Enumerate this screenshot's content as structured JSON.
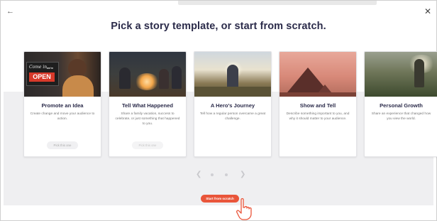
{
  "header": {
    "title": "Pick a story template, or start from scratch.",
    "back_icon": "back-arrow-icon",
    "close_icon": "close-icon"
  },
  "cards": [
    {
      "name": "Promote an Idea",
      "description": "Create change and move your audience to action.",
      "button": "Pick this one",
      "thumb_text": [
        "Come in",
        "we're",
        "OPEN"
      ]
    },
    {
      "name": "Tell What Happened",
      "description": "Share a family vacation, success to celebrate, or just something that happened to you.",
      "button": "Pick this one"
    },
    {
      "name": "A Hero's Journey",
      "description": "Tell how a regular person overcame a great challenge."
    },
    {
      "name": "Show and Tell",
      "description": "Describe something important to you, and why it should matter to your audience."
    },
    {
      "name": "Personal Growth",
      "description": "Share an experience that changed how you view the world."
    }
  ],
  "carousel": {
    "prev_icon": "chevron-left-icon",
    "next_icon": "chevron-right-icon",
    "pages": 3
  },
  "start_button": "Start from scratch",
  "cursor_icon": "hand-pointer-icon",
  "colors": {
    "accent": "#e9553a",
    "title": "#2b2b4a",
    "band": "#efeff1"
  }
}
